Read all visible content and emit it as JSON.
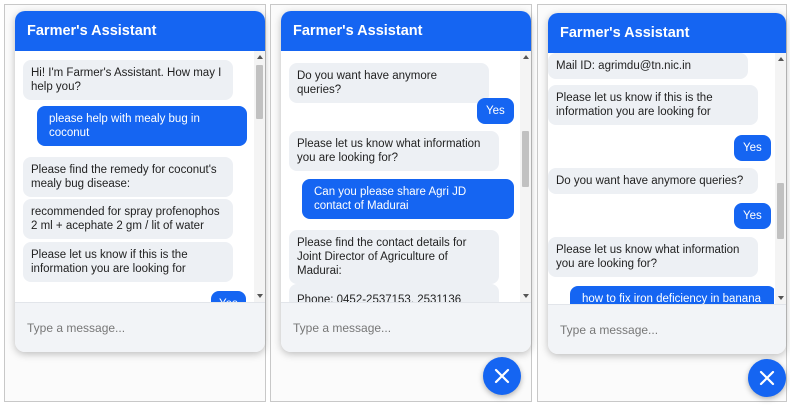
{
  "app": {
    "title": "Farmer's Assistant",
    "accent": "#1565f2"
  },
  "input": {
    "placeholder": "Type a message..."
  },
  "panels": [
    {
      "messages": [
        {
          "from": "bot",
          "text": "Hi! I'm Farmer's Assistant. How may I help you?"
        },
        {
          "from": "user",
          "text": "please help with mealy bug in coconut"
        },
        {
          "from": "bot",
          "text": "Please find the remedy for coconut's mealy bug disease:"
        },
        {
          "from": "bot",
          "text": "recommended for spray profenophos 2 ml + acephate 2 gm / lit of water"
        },
        {
          "from": "bot",
          "text": "Please let us know if this is the information you are looking for"
        },
        {
          "from": "user",
          "text": "Yes"
        }
      ]
    },
    {
      "messages": [
        {
          "from": "bot",
          "text": "Do you want have anymore queries?"
        },
        {
          "from": "user",
          "text": "Yes"
        },
        {
          "from": "bot",
          "text": "Please let us know what information you are looking for?"
        },
        {
          "from": "user",
          "text": "Can you please share Agri JD contact of Madurai"
        },
        {
          "from": "bot",
          "text": "Please find the contact details for Joint Director of Agriculture of Madurai:"
        },
        {
          "from": "bot",
          "text": "Phone: 0452-2537153, 2531136"
        }
      ]
    },
    {
      "messages": [
        {
          "from": "bot",
          "text": "Mail ID: agrimdu@tn.nic.in"
        },
        {
          "from": "bot",
          "text": "Please let us know if this is the information you are looking for"
        },
        {
          "from": "user",
          "text": "Yes"
        },
        {
          "from": "bot",
          "text": "Do you want have anymore queries?"
        },
        {
          "from": "user",
          "text": "Yes"
        },
        {
          "from": "bot",
          "text": "Please let us know what information you are looking for?"
        },
        {
          "from": "user",
          "text": "how to fix iron deficiency in banana"
        }
      ]
    }
  ]
}
